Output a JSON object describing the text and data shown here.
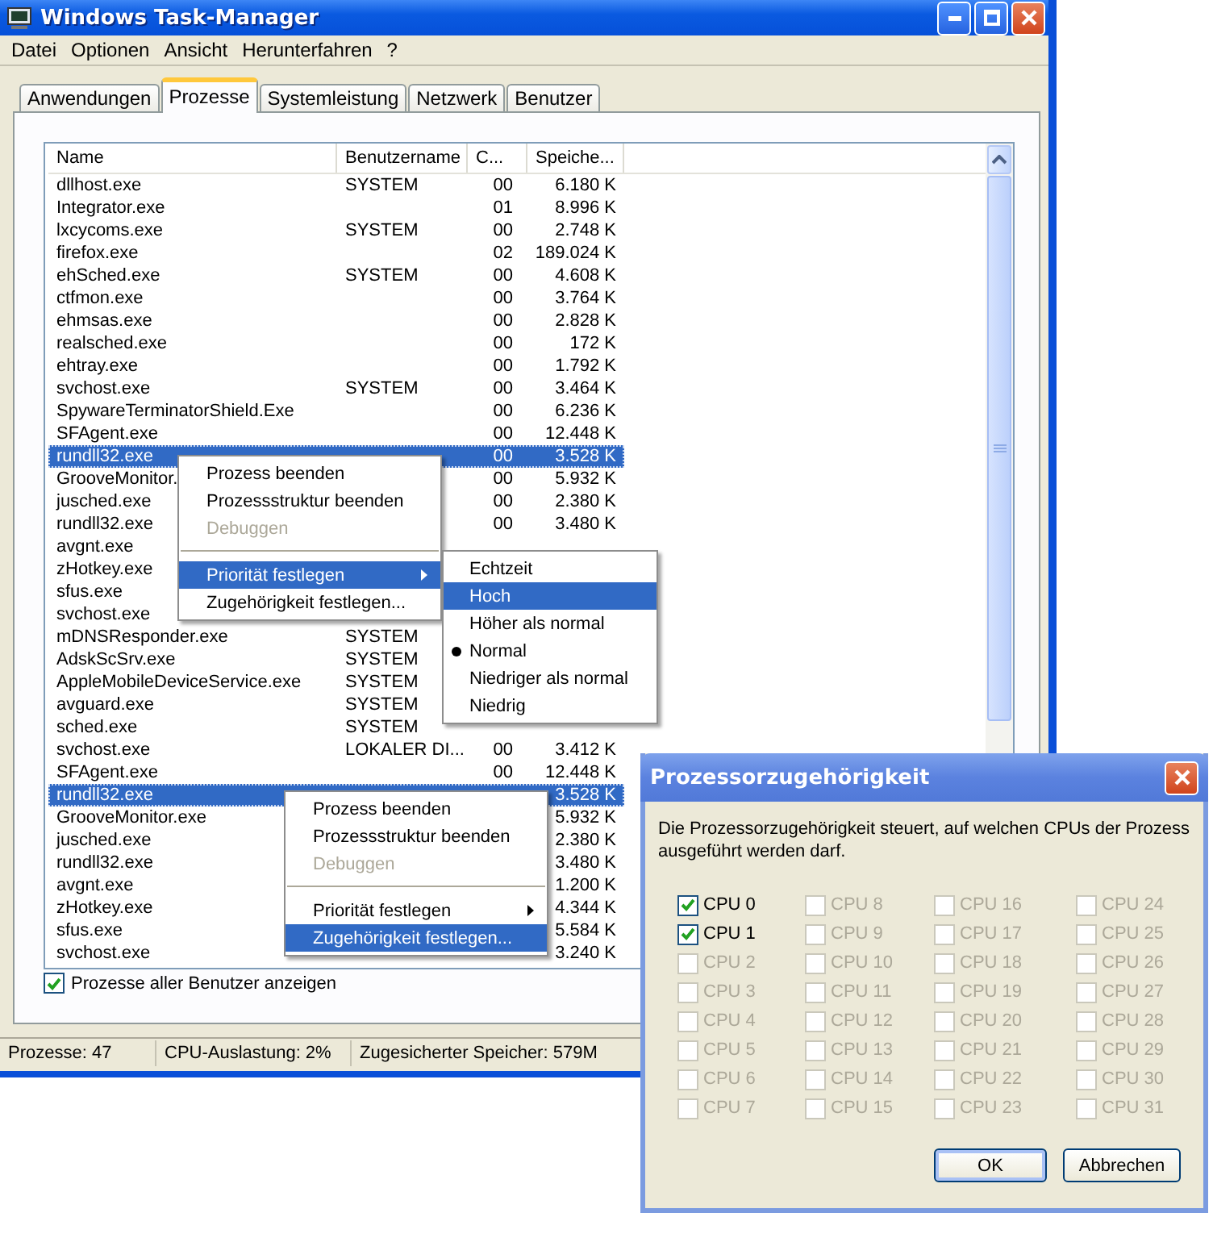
{
  "window": {
    "title": "Windows Task-Manager"
  },
  "menu_bar": [
    "Datei",
    "Optionen",
    "Ansicht",
    "Herunterfahren",
    "?"
  ],
  "tabs": [
    {
      "label": "Anwendungen",
      "selected": false
    },
    {
      "label": "Prozesse",
      "selected": true
    },
    {
      "label": "Systemleistung",
      "selected": false
    },
    {
      "label": "Netzwerk",
      "selected": false
    },
    {
      "label": "Benutzer",
      "selected": false
    }
  ],
  "table": {
    "columns": [
      "Name",
      "Benutzername",
      "C...",
      "Speiche..."
    ],
    "rows": [
      {
        "name": "dllhost.exe",
        "user": "SYSTEM",
        "cpu": "00",
        "memory": "6.180 K",
        "selected": false
      },
      {
        "name": "Integrator.exe",
        "cpu": "01",
        "memory": "8.996 K",
        "selected": false
      },
      {
        "name": "lxcycoms.exe",
        "user": "SYSTEM",
        "cpu": "00",
        "memory": "2.748 K",
        "selected": false
      },
      {
        "name": "firefox.exe",
        "cpu": "02",
        "memory": "189.024 K",
        "selected": false
      },
      {
        "name": "ehSched.exe",
        "user": "SYSTEM",
        "cpu": "00",
        "memory": "4.608 K",
        "selected": false
      },
      {
        "name": "ctfmon.exe",
        "cpu": "00",
        "memory": "3.764 K",
        "selected": false
      },
      {
        "name": "ehmsas.exe",
        "cpu": "00",
        "memory": "2.828 K",
        "selected": false
      },
      {
        "name": "realsched.exe",
        "cpu": "00",
        "memory": "172 K",
        "selected": false
      },
      {
        "name": "ehtray.exe",
        "cpu": "00",
        "memory": "1.792 K",
        "selected": false
      },
      {
        "name": "svchost.exe",
        "user": "SYSTEM",
        "cpu": "00",
        "memory": "3.464 K",
        "selected": false
      },
      {
        "name": "SpywareTerminatorShield.Exe",
        "cpu": "00",
        "memory": "6.236 K",
        "selected": false
      },
      {
        "name": "SFAgent.exe",
        "cpu": "00",
        "memory": "12.448 K",
        "selected": false
      },
      {
        "name": "rundll32.exe",
        "cpu": "00",
        "memory": "3.528 K",
        "selected": true
      },
      {
        "name": "GrooveMonitor.",
        "cpu": "00",
        "memory": "5.932 K",
        "selected": false
      },
      {
        "name": "jusched.exe",
        "cpu": "00",
        "memory": "2.380 K",
        "selected": false
      },
      {
        "name": "rundll32.exe",
        "cpu": "00",
        "memory": "3.480 K",
        "selected": false
      },
      {
        "name": "avgnt.exe",
        "selected": false
      },
      {
        "name": "zHotkey.exe",
        "selected": false
      },
      {
        "name": "sfus.exe",
        "selected": false
      },
      {
        "name": "svchost.exe",
        "selected": false
      },
      {
        "name": "mDNSResponder.exe",
        "user": "SYSTEM",
        "selected": false
      },
      {
        "name": "AdskScSrv.exe",
        "user": "SYSTEM",
        "selected": false
      },
      {
        "name": "AppleMobileDeviceService.exe",
        "user": "SYSTEM",
        "selected": false
      },
      {
        "name": "avguard.exe",
        "user": "SYSTEM",
        "selected": false
      },
      {
        "name": "sched.exe",
        "user": "SYSTEM",
        "selected": false
      },
      {
        "name": "svchost.exe",
        "user": "LOKALER DI...",
        "cpu": "00",
        "memory": "3.412 K",
        "selected": false
      },
      {
        "name": "SFAgent.exe",
        "cpu": "00",
        "memory": "12.448 K",
        "selected": false
      },
      {
        "name": "rundll32.exe",
        "memory": "3.528 K",
        "selected": true
      },
      {
        "name": "GrooveMonitor.exe",
        "memory": "5.932 K",
        "selected": false
      },
      {
        "name": "jusched.exe",
        "memory": "2.380 K",
        "selected": false
      },
      {
        "name": "rundll32.exe",
        "memory": "3.480 K",
        "selected": false
      },
      {
        "name": "avgnt.exe",
        "memory": "1.200 K",
        "selected": false
      },
      {
        "name": "zHotkey.exe",
        "memory": "4.344 K",
        "selected": false
      },
      {
        "name": "sfus.exe",
        "memory": "5.584 K",
        "selected": false
      },
      {
        "name": "svchost.exe",
        "memory": "3.240 K",
        "selected": false
      }
    ]
  },
  "show_all_users": {
    "label": "Prozesse aller Benutzer anzeigen",
    "checked": true
  },
  "status_bar": [
    "Prozesse: 47",
    "CPU-Auslastung: 2%",
    "Zugesicherter Speicher: 579M"
  ],
  "context_menus": [
    {
      "items": [
        {
          "kind": "command",
          "label": "Prozess beenden",
          "disabled": false,
          "selected": false
        },
        {
          "kind": "command",
          "label": "Prozessstruktur beenden",
          "disabled": false,
          "selected": false
        },
        {
          "kind": "command",
          "label": "Debuggen",
          "disabled": true,
          "selected": false
        },
        {
          "kind": "separator"
        },
        {
          "kind": "submenu",
          "label": "Priorität festlegen",
          "disabled": false,
          "selected": true
        },
        {
          "kind": "command",
          "label": "Zugehörigkeit festlegen...",
          "disabled": false,
          "selected": false
        }
      ]
    },
    {
      "items": [
        {
          "kind": "command",
          "label": "Prozess beenden",
          "disabled": false,
          "selected": false
        },
        {
          "kind": "command",
          "label": "Prozessstruktur beenden",
          "disabled": false,
          "selected": false
        },
        {
          "kind": "command",
          "label": "Debuggen",
          "disabled": true,
          "selected": false
        },
        {
          "kind": "separator"
        },
        {
          "kind": "submenu",
          "label": "Priorität festlegen",
          "disabled": false,
          "selected": false
        },
        {
          "kind": "command",
          "label": "Zugehörigkeit festlegen...",
          "disabled": false,
          "selected": true
        }
      ]
    }
  ],
  "priority_submenu": {
    "items": [
      {
        "label": "Echtzeit",
        "selected": false,
        "checked": false
      },
      {
        "label": "Hoch",
        "selected": true,
        "checked": false
      },
      {
        "label": "Höher als normal",
        "selected": false,
        "checked": false
      },
      {
        "label": "Normal",
        "selected": false,
        "checked": true
      },
      {
        "label": "Niedriger als normal",
        "selected": false,
        "checked": false
      },
      {
        "label": "Niedrig",
        "selected": false,
        "checked": false
      }
    ]
  },
  "affinity_dialog": {
    "title": "Prozessorzugehörigkeit",
    "description": "Die Prozessorzugehörigkeit steuert, auf welchen CPUs der Prozess ausgeführt werden darf.",
    "cpus": [
      {
        "label": "CPU 0",
        "checked": true,
        "disabled": false
      },
      {
        "label": "CPU 1",
        "checked": true,
        "disabled": false
      },
      {
        "label": "CPU 2",
        "checked": false,
        "disabled": true
      },
      {
        "label": "CPU 3",
        "checked": false,
        "disabled": true
      },
      {
        "label": "CPU 4",
        "checked": false,
        "disabled": true
      },
      {
        "label": "CPU 5",
        "checked": false,
        "disabled": true
      },
      {
        "label": "CPU 6",
        "checked": false,
        "disabled": true
      },
      {
        "label": "CPU 7",
        "checked": false,
        "disabled": true
      },
      {
        "label": "CPU 8",
        "checked": false,
        "disabled": true
      },
      {
        "label": "CPU 9",
        "checked": false,
        "disabled": true
      },
      {
        "label": "CPU 10",
        "checked": false,
        "disabled": true
      },
      {
        "label": "CPU 11",
        "checked": false,
        "disabled": true
      },
      {
        "label": "CPU 12",
        "checked": false,
        "disabled": true
      },
      {
        "label": "CPU 13",
        "checked": false,
        "disabled": true
      },
      {
        "label": "CPU 14",
        "checked": false,
        "disabled": true
      },
      {
        "label": "CPU 15",
        "checked": false,
        "disabled": true
      },
      {
        "label": "CPU 16",
        "checked": false,
        "disabled": true
      },
      {
        "label": "CPU 17",
        "checked": false,
        "disabled": true
      },
      {
        "label": "CPU 18",
        "checked": false,
        "disabled": true
      },
      {
        "label": "CPU 19",
        "checked": false,
        "disabled": true
      },
      {
        "label": "CPU 20",
        "checked": false,
        "disabled": true
      },
      {
        "label": "CPU 21",
        "checked": false,
        "disabled": true
      },
      {
        "label": "CPU 22",
        "checked": false,
        "disabled": true
      },
      {
        "label": "CPU 23",
        "checked": false,
        "disabled": true
      },
      {
        "label": "CPU 24",
        "checked": false,
        "disabled": true
      },
      {
        "label": "CPU 25",
        "checked": false,
        "disabled": true
      },
      {
        "label": "CPU 26",
        "checked": false,
        "disabled": true
      },
      {
        "label": "CPU 27",
        "checked": false,
        "disabled": true
      },
      {
        "label": "CPU 28",
        "checked": false,
        "disabled": true
      },
      {
        "label": "CPU 29",
        "checked": false,
        "disabled": true
      },
      {
        "label": "CPU 30",
        "checked": false,
        "disabled": true
      },
      {
        "label": "CPU 31",
        "checked": false,
        "disabled": true
      }
    ],
    "buttons": [
      {
        "label": "OK",
        "default": true
      },
      {
        "label": "Abbrechen",
        "default": false
      }
    ]
  }
}
